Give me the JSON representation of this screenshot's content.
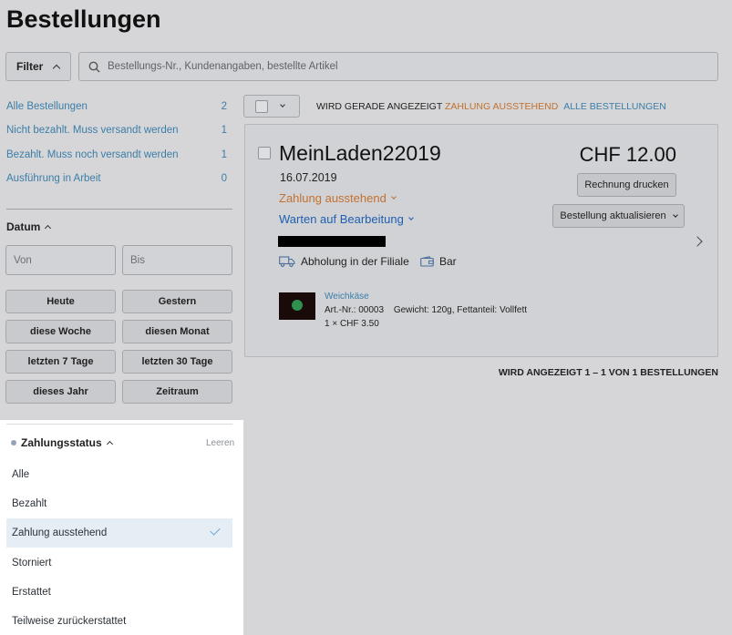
{
  "page": {
    "title": "Bestellungen"
  },
  "toolbar": {
    "filter_label": "Filter",
    "search_placeholder": "Bestellungs-Nr., Kundenangaben, bestellte Artikel"
  },
  "sidebar": {
    "stats": [
      {
        "label": "Alle Bestellungen",
        "count": "2"
      },
      {
        "label": "Nicht bezahlt. Muss versandt werden",
        "count": "1"
      },
      {
        "label": "Bezahlt. Muss noch versandt werden",
        "count": "1"
      },
      {
        "label": "Ausführung in Arbeit",
        "count": "0"
      }
    ],
    "date": {
      "heading": "Datum",
      "from_placeholder": "Von",
      "to_placeholder": "Bis",
      "quick": [
        "Heute",
        "Gestern",
        "diese Woche",
        "diesen Monat",
        "letzten 7 Tage",
        "letzten 30 Tage",
        "dieses Jahr",
        "Zeitraum"
      ]
    },
    "payment": {
      "heading": "Zahlungsstatus",
      "clear": "Leeren",
      "options": [
        "Alle",
        "Bezahlt",
        "Zahlung ausstehend",
        "Storniert",
        "Erstattet",
        "Teilweise zurückerstattet"
      ],
      "selected": "Zahlung ausstehend"
    }
  },
  "list": {
    "showing_prefix": "WIRD GERADE ANGEZEIGT",
    "showing_filter": "ZAHLUNG AUSSTEHEND",
    "showing_all": "ALLE BESTELLUNGEN",
    "footer": "WIRD ANGEZEIGT 1 – 1 VON 1 BESTELLUNGEN"
  },
  "order": {
    "shop": "MeinLaden22019",
    "date": "16.07.2019",
    "payment_status": "Zahlung ausstehend",
    "fulfillment_status": "Warten auf Bearbeitung",
    "shipping": "Abholung in der Filiale",
    "payment_method": "Bar",
    "total": "CHF 12.00",
    "print_button": "Rechnung drucken",
    "update_button": "Bestellung aktualisieren",
    "item": {
      "name": "Weichkäse",
      "sku": "Art.-Nr.: 00003",
      "attributes": "Gewicht: 120g, Fettanteil: Vollfett",
      "quantity_price": "1 × CHF 3.50"
    }
  },
  "colors": {
    "accent_blue": "#3b7ea8",
    "pending_orange": "#c2712f",
    "fulfillment_blue": "#1f5fb0"
  }
}
